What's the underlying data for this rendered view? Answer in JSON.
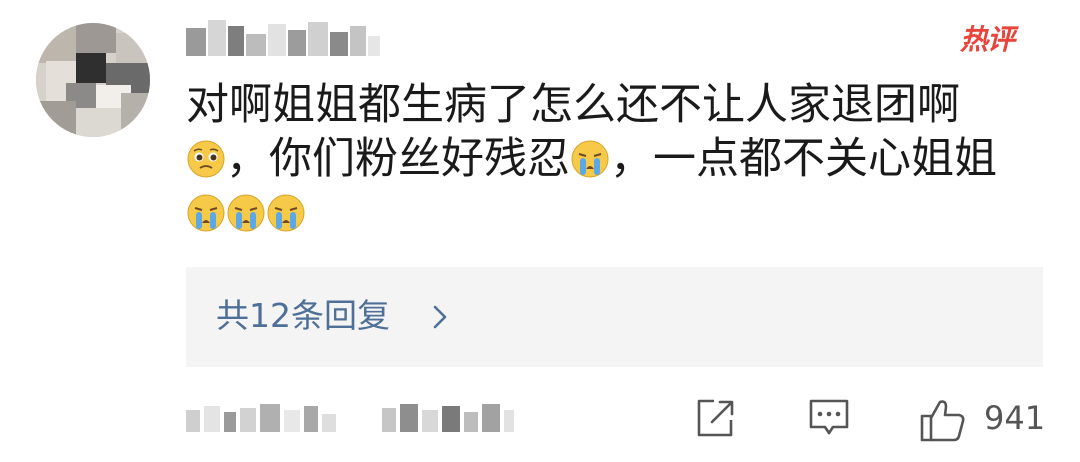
{
  "comment": {
    "hot_badge": "热评",
    "line1": "对啊姐姐都生病了怎么还不让人家退团啊",
    "line2_a": "，你们粉丝好残忍",
    "line2_b": "，一点都不关心姐姐",
    "emojis": [
      "pleading-face",
      "crying-face",
      "crying-face",
      "crying-face",
      "crying-face"
    ]
  },
  "replies": {
    "label": "共12条回复"
  },
  "actions": {
    "likes": "941"
  },
  "colors": {
    "hot_badge": "#e8443c",
    "replies_link": "#4e6f97",
    "replies_bg": "#f4f4f4",
    "text": "#1a1a1a",
    "icon": "#555555"
  }
}
